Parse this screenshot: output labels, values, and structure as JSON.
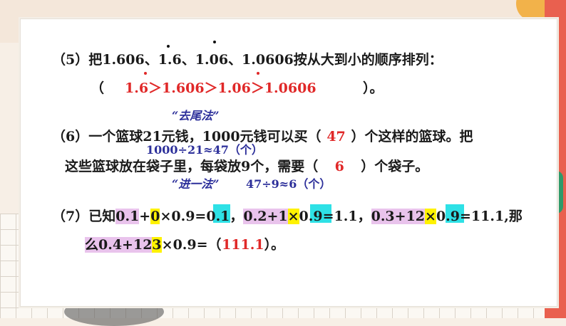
{
  "q5": {
    "line1": "（5）把1.606、1.6、1.06、1.0606按从大到小的顺序排列：",
    "open_paren": "（",
    "answer": "1.6＞1.606＞1.06＞1.0606",
    "close_paren": "）。"
  },
  "q6": {
    "note_top": "“去尾法”",
    "line1_a": "（6）一个篮球21元钱，1000元钱可以买（",
    "answer1": "47",
    "line1_b": "）个这样的篮球。把",
    "calc1": "1000÷21≈47（个）",
    "line2_a": "这些篮球放在袋子里，每袋放9个，需要（",
    "answer2": "6",
    "line2_b": "）个袋子。",
    "note_bottom": "“进一法”",
    "calc2": "47÷9≈6（个）"
  },
  "q7": {
    "l1_p1": "（7）已知",
    "l1_p2": "0.1",
    "l1_p3": "+",
    "l1_p4": "0",
    "l1_p5": "×",
    "l1_p6": "0.9=0.1",
    "l1_p7": "，",
    "l1_p8": "0.2+1",
    "l1_p9": "×",
    "l1_p10": "0.9=1.1",
    "l1_p11": "，",
    "l1_p12": "0.3+12",
    "l1_p13": "×",
    "l1_p14": "0.9=11.1",
    "l1_p15": ",那",
    "l2_p1": "么0.4+12",
    "l2_p2": "3",
    "l2_p3": "×0.9=（",
    "answer": "111.1",
    "l2_end": "）。"
  },
  "colors": {
    "answer_red": "#e02828",
    "note_blue": "#2c2f9a",
    "highlight_pink": "#e9c3ec",
    "highlight_yellow": "#fff200",
    "highlight_cyan": "#2ee1e6"
  }
}
